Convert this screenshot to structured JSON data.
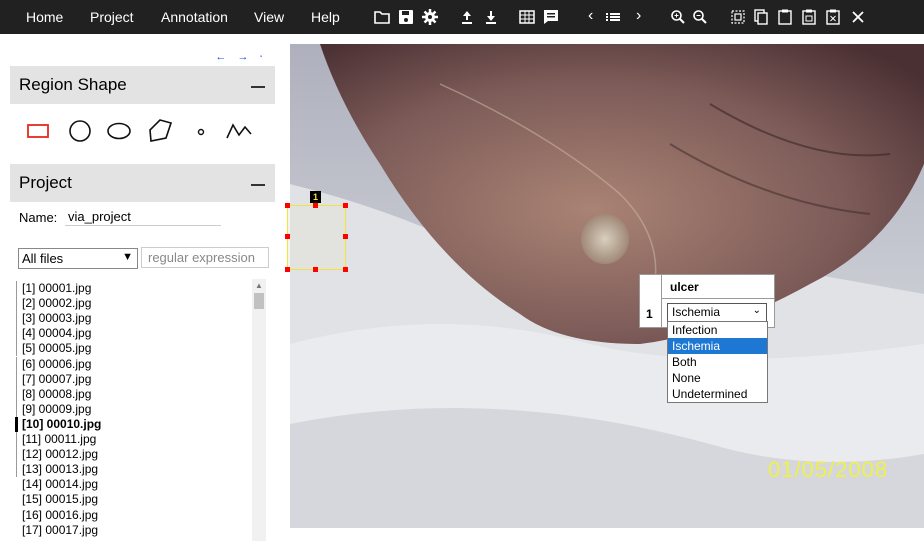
{
  "menu": {
    "items": [
      "Home",
      "Project",
      "Annotation",
      "View",
      "Help"
    ]
  },
  "toolbar": {
    "icons": [
      "folder-icon",
      "save-icon",
      "settings-icon",
      "upload-icon",
      "download-icon",
      "grid-icon",
      "message-icon",
      "prev-icon",
      "list-icon",
      "next-icon",
      "zoom-in-icon",
      "zoom-out-icon",
      "select-all-icon",
      "copy-icon",
      "paste-icon",
      "paste-special-icon",
      "delete-icon",
      "close-icon"
    ]
  },
  "panel_nav": "← → ⋅",
  "region_shape": {
    "title": "Region Shape",
    "shapes": [
      "rectangle",
      "circle",
      "ellipse",
      "polygon",
      "point",
      "polyline"
    ],
    "accent": "#e8281e"
  },
  "project": {
    "title": "Project",
    "name_label": "Name:",
    "name_value": "via_project",
    "filter_selected": "All files",
    "regex_placeholder": "regular expression",
    "files": [
      "[1] 00001.jpg",
      "[2] 00002.jpg",
      "[3] 00003.jpg",
      "[4] 00004.jpg",
      "[5] 00005.jpg",
      "[6] 00006.jpg",
      "[7] 00007.jpg",
      "[8] 00008.jpg",
      "[9] 00009.jpg",
      "[10] 00010.jpg",
      "[11] 00011.jpg",
      "[12] 00012.jpg",
      "[13] 00013.jpg",
      "[14] 00014.jpg",
      "[15] 00015.jpg",
      "[16] 00016.jpg",
      "[17] 00017.jpg"
    ],
    "current_index": 9
  },
  "image": {
    "date_stamp": "01/05/2008",
    "region_label": "1"
  },
  "attribute_editor": {
    "header": "ulcer",
    "row_number": "1",
    "selected": "Ischemia",
    "options": [
      "Infection",
      "Ischemia",
      "Both",
      "None",
      "Undetermined"
    ],
    "highlight_color": "#1e77d3"
  }
}
